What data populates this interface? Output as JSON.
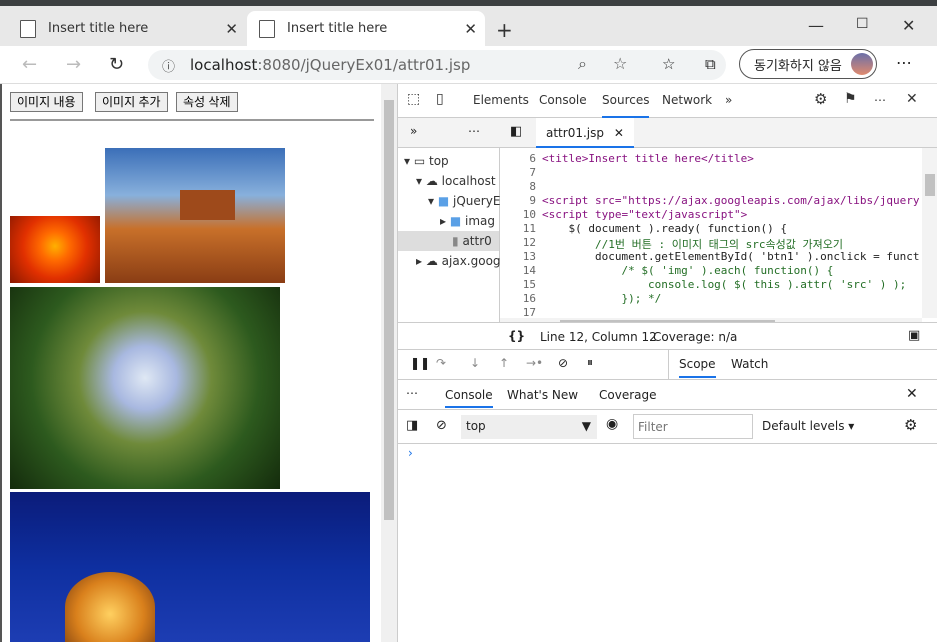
{
  "browser": {
    "tab1_title": "Insert title here",
    "tab2_title": "Insert title here",
    "url_host": "localhost",
    "url_rest": ":8080/jQueryEx01/attr01.jsp",
    "sync_label": "동기화하지 않음"
  },
  "page": {
    "buttons": [
      "이미지 내용",
      "이미지 추가",
      "속성 삭제"
    ]
  },
  "devtools": {
    "tabs": [
      "Elements",
      "Console",
      "Sources",
      "Network"
    ],
    "active_tab": "Sources",
    "tree": [
      "top",
      "localhost",
      "jQueryE",
      "imag",
      "attr0",
      "ajax.goog"
    ],
    "file_tab": "attr01.jsp",
    "code": [
      {
        "n": "6",
        "t": "<title>Insert title here</title>"
      },
      {
        "n": "7",
        "t": ""
      },
      {
        "n": "8",
        "t": ""
      },
      {
        "n": "9",
        "t": "<script src=\"https://ajax.googleapis.com/ajax/libs/jquery"
      },
      {
        "n": "10",
        "t": "<script type=\"text/javascript\">"
      },
      {
        "n": "11",
        "t": "    $( document ).ready( function() {"
      },
      {
        "n": "12",
        "t": "        //1번 버튼 : 이미지 태그의 src속성값 가져오기"
      },
      {
        "n": "13",
        "t": "        document.getElementById( 'btn1' ).onclick = funct"
      },
      {
        "n": "14",
        "t": "            /* $( 'img' ).each( function() {"
      },
      {
        "n": "15",
        "t": "                console.log( $( this ).attr( 'src' ) );"
      },
      {
        "n": "16",
        "t": "            }); */"
      },
      {
        "n": "17",
        "t": ""
      }
    ],
    "status_pos": "Line 12, Column 12",
    "status_cov": "Coverage: n/a",
    "scope_tabs": [
      "Scope",
      "Watch"
    ],
    "drawer_tabs": [
      "Console",
      "What's New",
      "Coverage"
    ],
    "context": "top",
    "filter_placeholder": "Filter",
    "levels": "Default levels"
  },
  "colors": {
    "active_tab": "#1a73e8",
    "tag": "#881280",
    "string": "#1a1aa6",
    "comment": "#236e25",
    "keyword": "#aa0d91"
  }
}
